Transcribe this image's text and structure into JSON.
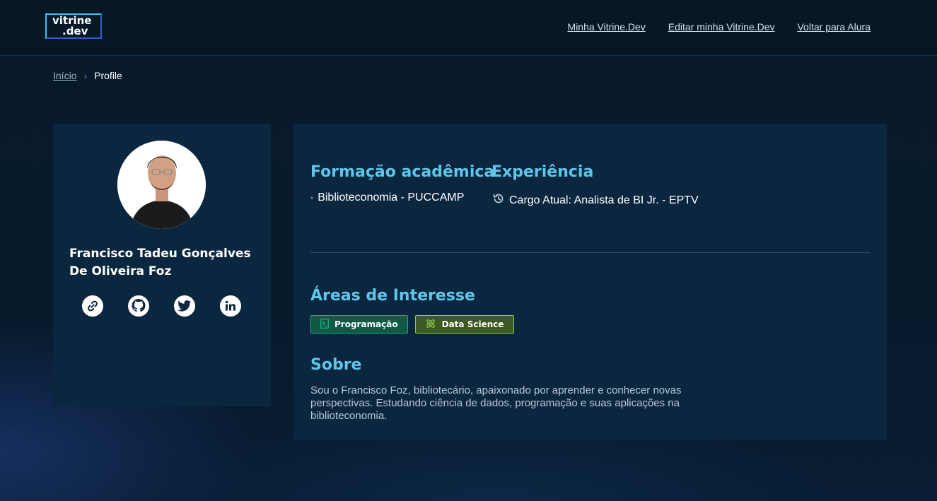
{
  "header": {
    "logo": {
      "line1": "vitrine",
      "line2": ".dev"
    },
    "nav": [
      {
        "label": "Minha Vitrine.Dev"
      },
      {
        "label": "Editar minha Vitrine.Dev"
      },
      {
        "label": "Voltar para Alura"
      }
    ]
  },
  "breadcrumb": {
    "home": "Início",
    "separator": "›",
    "current": "Profile"
  },
  "profile": {
    "name": "Francisco Tadeu Gonçalves De Oliveira Foz",
    "socials": [
      {
        "icon": "link-icon"
      },
      {
        "icon": "github-icon"
      },
      {
        "icon": "twitter-icon"
      },
      {
        "icon": "linkedin-icon"
      }
    ]
  },
  "education": {
    "title": "Formação acadêmica",
    "items": [
      {
        "label": "Biblioteconomia - PUCCAMP"
      }
    ]
  },
  "experience": {
    "title": "Experiência",
    "items": [
      {
        "label": "Cargo Atual: Analista de BI Jr. - EPTV"
      }
    ]
  },
  "interests": {
    "title": "Áreas de Interesse",
    "tags": [
      {
        "label": "Programação",
        "icon": "terminal-icon",
        "color": "#19b07a"
      },
      {
        "label": "Data Science",
        "icon": "atom-icon",
        "color": "#8ecf4c"
      }
    ]
  },
  "about": {
    "title": "Sobre",
    "text": "Sou o Francisco Foz, bibliotecário, apaixonado por aprender e conhecer novas perspectivas. Estudando ciência de dados, programação e suas aplicações na biblioteconomia."
  },
  "colors": {
    "accent": "#5fc6ea",
    "background": "#071a2c",
    "card": "#0b2740"
  }
}
